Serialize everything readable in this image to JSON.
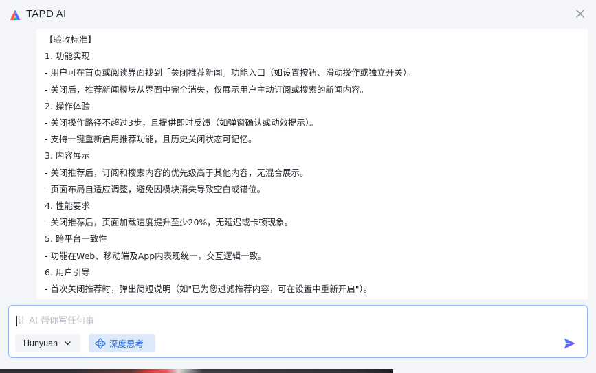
{
  "app": {
    "title": "TAPD AI"
  },
  "content": {
    "lines": [
      "【验收标准】",
      "1. 功能实现",
      "- 用户可在首页或阅读界面找到「关闭推荐新闻」功能入口（如设置按钮、滑动操作或独立开关）。",
      "- 关闭后，推荐新闻模块从界面中完全消失，仅展示用户主动订阅或搜索的新闻内容。",
      "2. 操作体验",
      "- 关闭操作路径不超过3步，且提供即时反馈（如弹窗确认或动效提示）。",
      "- 支持一键重新启用推荐功能，且历史关闭状态可记忆。",
      "3. 内容展示",
      "- 关闭推荐后，订阅和搜索内容的优先级高于其他内容，无混合展示。",
      "- 页面布局自适应调整，避免因模块消失导致空白或错位。",
      "4. 性能要求",
      "- 关闭推荐后，页面加载速度提升至少20%，无延迟或卡顿现象。",
      "5. 跨平台一致性",
      "- 功能在Web、移动端及App内表现统一，交互逻辑一致。",
      "6. 用户引导",
      "- 首次关闭推荐时，弹出简短说明（如\"已为您过滤推荐内容，可在设置中重新开启\"）。"
    ]
  },
  "composer": {
    "placeholder": "让 AI 帮你写任何事",
    "value": "",
    "model_label": "Hunyuan",
    "deep_think_label": "深度思考"
  },
  "colors": {
    "accent": "#2f6fde",
    "border": "#8fb8f5",
    "think_bg": "#dce9fb"
  },
  "icons": {
    "logo": "tapd-ai-logo",
    "close": "close-icon",
    "chevron": "chevron-down-icon",
    "think": "atom-icon",
    "send": "send-icon"
  }
}
